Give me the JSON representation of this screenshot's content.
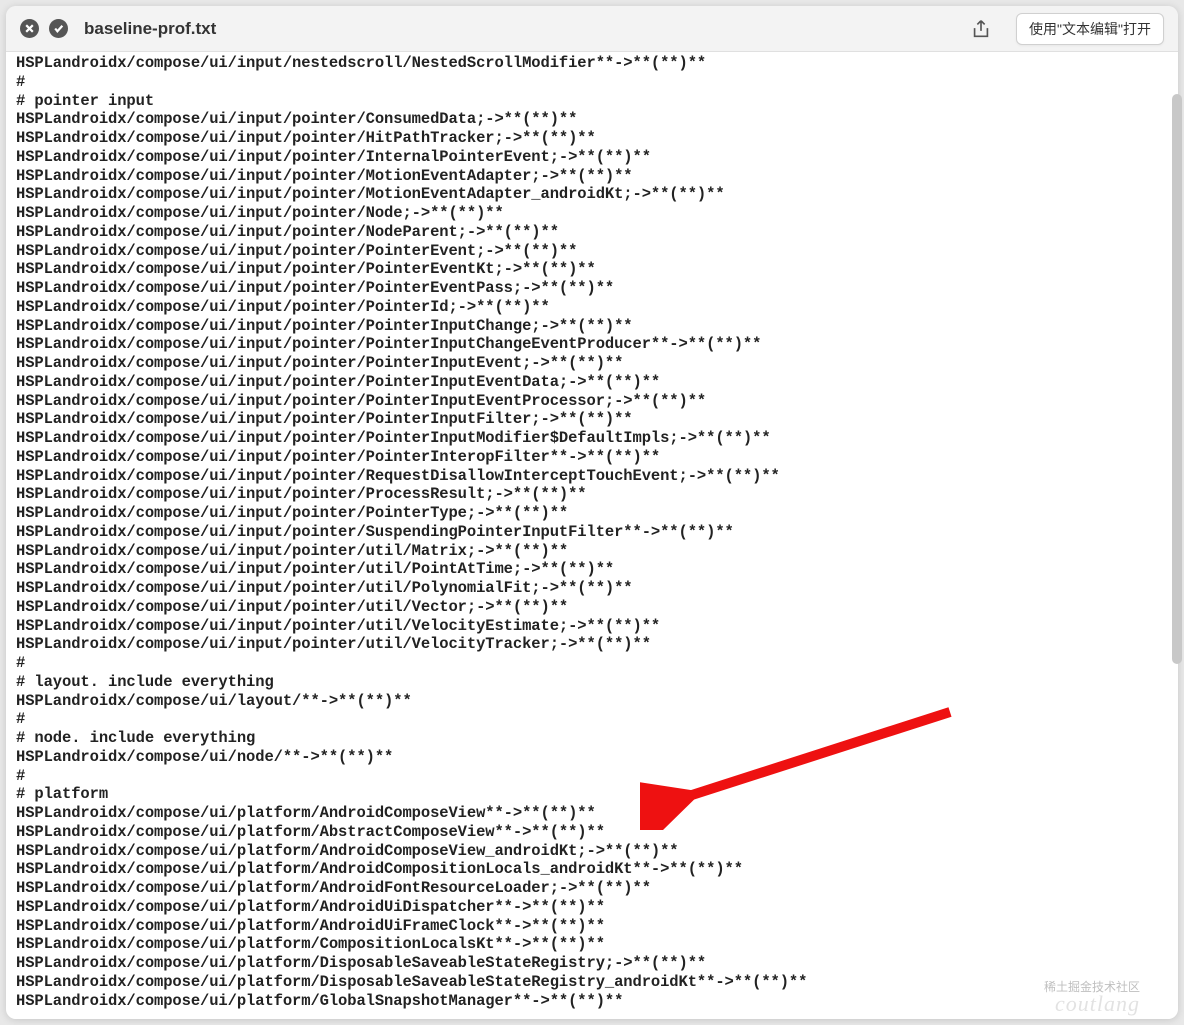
{
  "window": {
    "title": "baseline-prof.txt",
    "open_button": "使用\"文本编辑\"打开"
  },
  "watermarks": {
    "top": "稀土掘金技术社区",
    "bottom": "coutlang"
  },
  "lines": [
    "HSPLandroidx/compose/ui/input/nestedscroll/NestedScrollModifier**->**(**)**",
    "#",
    "# pointer input",
    "HSPLandroidx/compose/ui/input/pointer/ConsumedData;->**(**)**",
    "HSPLandroidx/compose/ui/input/pointer/HitPathTracker;->**(**)**",
    "HSPLandroidx/compose/ui/input/pointer/InternalPointerEvent;->**(**)**",
    "HSPLandroidx/compose/ui/input/pointer/MotionEventAdapter;->**(**)**",
    "HSPLandroidx/compose/ui/input/pointer/MotionEventAdapter_androidKt;->**(**)**",
    "HSPLandroidx/compose/ui/input/pointer/Node;->**(**)**",
    "HSPLandroidx/compose/ui/input/pointer/NodeParent;->**(**)**",
    "HSPLandroidx/compose/ui/input/pointer/PointerEvent;->**(**)**",
    "HSPLandroidx/compose/ui/input/pointer/PointerEventKt;->**(**)**",
    "HSPLandroidx/compose/ui/input/pointer/PointerEventPass;->**(**)**",
    "HSPLandroidx/compose/ui/input/pointer/PointerId;->**(**)**",
    "HSPLandroidx/compose/ui/input/pointer/PointerInputChange;->**(**)**",
    "HSPLandroidx/compose/ui/input/pointer/PointerInputChangeEventProducer**->**(**)**",
    "HSPLandroidx/compose/ui/input/pointer/PointerInputEvent;->**(**)**",
    "HSPLandroidx/compose/ui/input/pointer/PointerInputEventData;->**(**)**",
    "HSPLandroidx/compose/ui/input/pointer/PointerInputEventProcessor;->**(**)**",
    "HSPLandroidx/compose/ui/input/pointer/PointerInputFilter;->**(**)**",
    "HSPLandroidx/compose/ui/input/pointer/PointerInputModifier$DefaultImpls;->**(**)**",
    "HSPLandroidx/compose/ui/input/pointer/PointerInteropFilter**->**(**)**",
    "HSPLandroidx/compose/ui/input/pointer/RequestDisallowInterceptTouchEvent;->**(**)**",
    "HSPLandroidx/compose/ui/input/pointer/ProcessResult;->**(**)**",
    "HSPLandroidx/compose/ui/input/pointer/PointerType;->**(**)**",
    "HSPLandroidx/compose/ui/input/pointer/SuspendingPointerInputFilter**->**(**)**",
    "HSPLandroidx/compose/ui/input/pointer/util/Matrix;->**(**)**",
    "HSPLandroidx/compose/ui/input/pointer/util/PointAtTime;->**(**)**",
    "HSPLandroidx/compose/ui/input/pointer/util/PolynomialFit;->**(**)**",
    "HSPLandroidx/compose/ui/input/pointer/util/Vector;->**(**)**",
    "HSPLandroidx/compose/ui/input/pointer/util/VelocityEstimate;->**(**)**",
    "HSPLandroidx/compose/ui/input/pointer/util/VelocityTracker;->**(**)**",
    "#",
    "# layout. include everything",
    "HSPLandroidx/compose/ui/layout/**->**(**)**",
    "#",
    "# node. include everything",
    "HSPLandroidx/compose/ui/node/**->**(**)**",
    "#",
    "# platform",
    "HSPLandroidx/compose/ui/platform/AndroidComposeView**->**(**)**",
    "HSPLandroidx/compose/ui/platform/AbstractComposeView**->**(**)**",
    "HSPLandroidx/compose/ui/platform/AndroidComposeView_androidKt;->**(**)**",
    "HSPLandroidx/compose/ui/platform/AndroidCompositionLocals_androidKt**->**(**)**",
    "HSPLandroidx/compose/ui/platform/AndroidFontResourceLoader;->**(**)**",
    "HSPLandroidx/compose/ui/platform/AndroidUiDispatcher**->**(**)**",
    "HSPLandroidx/compose/ui/platform/AndroidUiFrameClock**->**(**)**",
    "HSPLandroidx/compose/ui/platform/CompositionLocalsKt**->**(**)**",
    "HSPLandroidx/compose/ui/platform/DisposableSaveableStateRegistry;->**(**)**",
    "HSPLandroidx/compose/ui/platform/DisposableSaveableStateRegistry_androidKt**->**(**)**",
    "HSPLandroidx/compose/ui/platform/GlobalSnapshotManager**->**(**)**"
  ]
}
